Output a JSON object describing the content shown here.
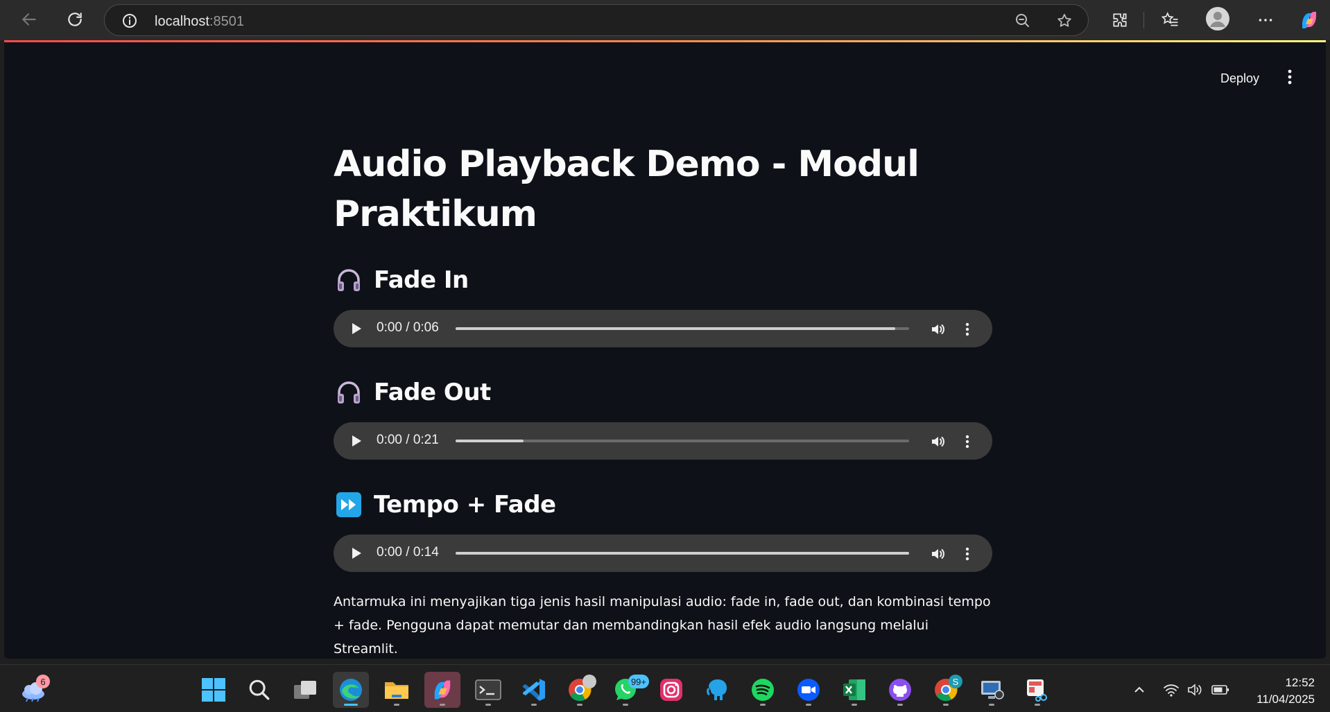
{
  "browser": {
    "url_host": "localhost",
    "url_port": ":8501"
  },
  "app": {
    "deploy_label": "Deploy",
    "title": "Audio Playback Demo - Modul Praktikum",
    "sections": [
      {
        "label": "Fade In",
        "icon": "headphones-icon",
        "time": "0:00 / 0:06",
        "progress": 0.97
      },
      {
        "label": "Fade Out",
        "icon": "headphones-icon",
        "time": "0:00 / 0:21",
        "progress": 0.15
      },
      {
        "label": "Tempo + Fade",
        "icon": "fast-forward-icon",
        "time": "0:00 / 0:14",
        "progress": 1.0
      }
    ],
    "description": "Antarmuka ini menyajikan tiga jenis hasil manipulasi audio: fade in, fade out, dan kombinasi tempo + fade. Pengguna dapat memutar dan membandingkan hasil efek audio langsung melalui Streamlit."
  },
  "taskbar": {
    "weather_badge": "6",
    "whatsapp_badge": "99+",
    "chrome_profile_badge": "S",
    "time": "12:52",
    "date": "11/04/2025"
  },
  "colors": {
    "app_bg": "#0e1117",
    "audio_bg": "#3b3b3b",
    "accent_gradient_start": "#ff4b4b",
    "accent_gradient_end": "#fffd80"
  }
}
